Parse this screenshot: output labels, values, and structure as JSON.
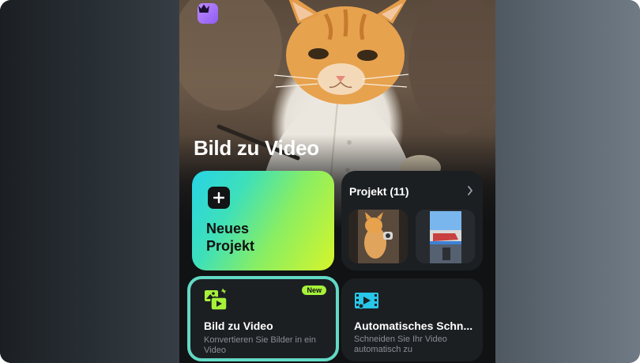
{
  "header": {
    "title": "Bild zu Video",
    "premium_icon": "crown-icon"
  },
  "new_project": {
    "label": "Neues Projekt",
    "icon": "plus-icon"
  },
  "projects": {
    "title": "Projekt (11)",
    "icon": "chevron-right-icon"
  },
  "features": [
    {
      "title": "Bild zu Video",
      "description": "Konvertieren Sie Bilder in ein Video",
      "badge": "New",
      "icon": "image-to-video-icon"
    },
    {
      "title": "Automatisches Schn...",
      "description": "Schneiden Sie Ihr Video automatisch zu",
      "icon": "auto-cut-icon"
    }
  ],
  "colors": {
    "accent": "#a6f13a",
    "highlight_border": "#62d9c5",
    "card_bg": "#1c1f22",
    "premium": "#9b6cf7"
  }
}
